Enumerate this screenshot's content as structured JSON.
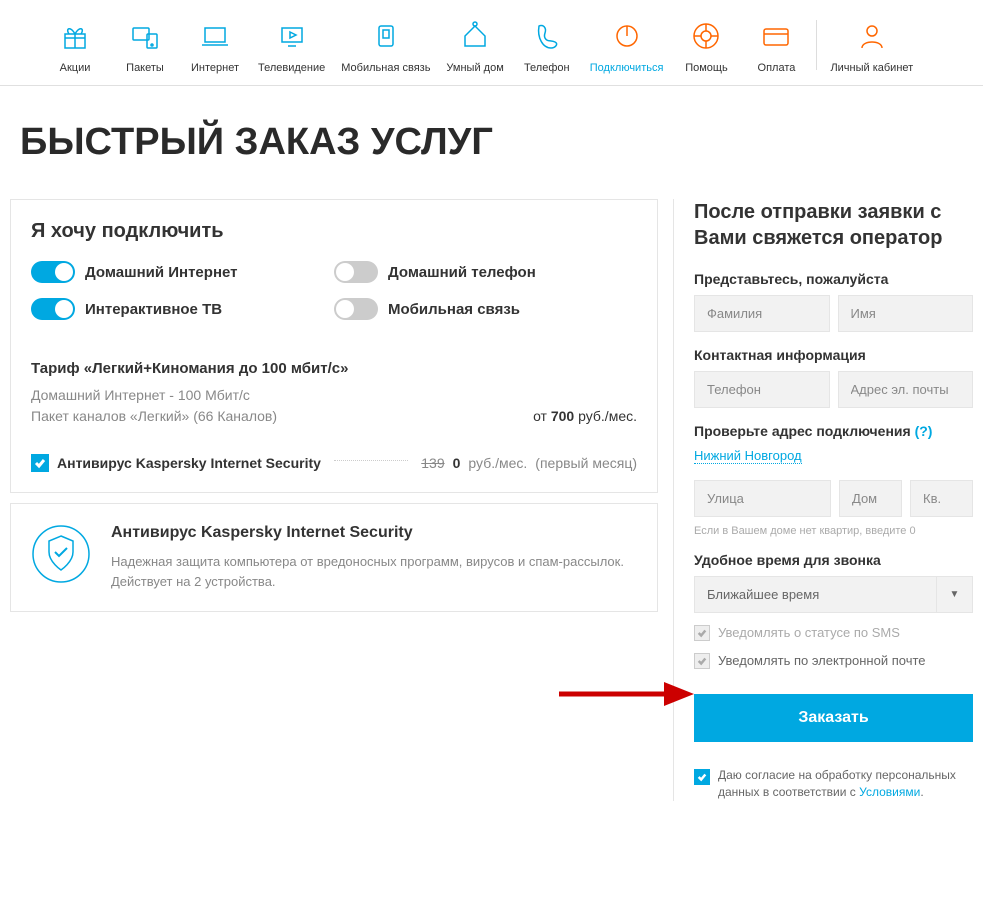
{
  "nav": [
    {
      "label": "Акции",
      "icon": "gift",
      "style": "blue"
    },
    {
      "label": "Пакеты",
      "icon": "devices",
      "style": "blue"
    },
    {
      "label": "Интернет",
      "icon": "laptop",
      "style": "blue"
    },
    {
      "label": "Телевидение",
      "icon": "tv",
      "style": "blue"
    },
    {
      "label": "Мобильная связь",
      "icon": "sim",
      "style": "blue"
    },
    {
      "label": "Умный дом",
      "icon": "home",
      "style": "blue"
    },
    {
      "label": "Телефон",
      "icon": "phone",
      "style": "blue"
    },
    {
      "label": "Подключиться",
      "icon": "power",
      "style": "orange",
      "highlight": true
    },
    {
      "label": "Помощь",
      "icon": "lifebuoy",
      "style": "orange"
    },
    {
      "label": "Оплата",
      "icon": "card",
      "style": "orange"
    },
    {
      "label": "Личный кабинет",
      "icon": "user",
      "style": "orange",
      "divider_before": true
    }
  ],
  "title": "БЫСТРЫЙ ЗАКАЗ УСЛУГ",
  "connect": {
    "heading": "Я хочу подключить",
    "toggles": [
      {
        "label": "Домашний Интернет",
        "on": true
      },
      {
        "label": "Домашний телефон",
        "on": false
      },
      {
        "label": "Интерактивное ТВ",
        "on": true
      },
      {
        "label": "Мобильная связь",
        "on": false
      }
    ],
    "tarif_title": "Тариф «Легкий+Киномания до 100 мбит/с»",
    "tarif_lines": [
      "Домашний Интернет - 100 Мбит/с",
      "Пакет каналов «Легкий» (66 Каналов)"
    ],
    "price_prefix": "от ",
    "price_value": "700",
    "price_unit": " руб./мес.",
    "addon": {
      "name": "Антивирус Kaspersky Internet Security",
      "old_price": "139",
      "new_price": "0",
      "unit": " руб./мес.",
      "note": "(первый месяц)"
    }
  },
  "av": {
    "title": "Антивирус Kaspersky Internet Security",
    "desc": "Надежная защита компьютера от вредоносных программ, вирусов и спам-рассылок. Действует на 2 устройства."
  },
  "form": {
    "heading": "После отправки заявки с Вами свяжется оператор",
    "name_label": "Представьтесь, пожалуйста",
    "surname_ph": "Фамилия",
    "firstname_ph": "Имя",
    "contact_label": "Контактная информация",
    "phone_ph": "Телефон",
    "email_ph": "Адрес эл. почты",
    "addr_label": "Проверьте адрес подключения",
    "addr_help": "(?)",
    "city": "Нижний Новгород",
    "street_ph": "Улица",
    "house_ph": "Дом",
    "apt_ph": "Кв.",
    "addr_hint": "Если в Вашем доме нет квартир, введите 0",
    "time_label": "Удобное время для звонка",
    "time_value": "Ближайшее время",
    "notify_sms": "Уведомлять о статусе по SMS",
    "notify_email": "Уведомлять по электронной почте",
    "order_btn": "Заказать",
    "consent_prefix": "Даю согласие на обработку персональных данных в соответствии с ",
    "consent_link": "Условиями",
    "consent_suffix": "."
  }
}
